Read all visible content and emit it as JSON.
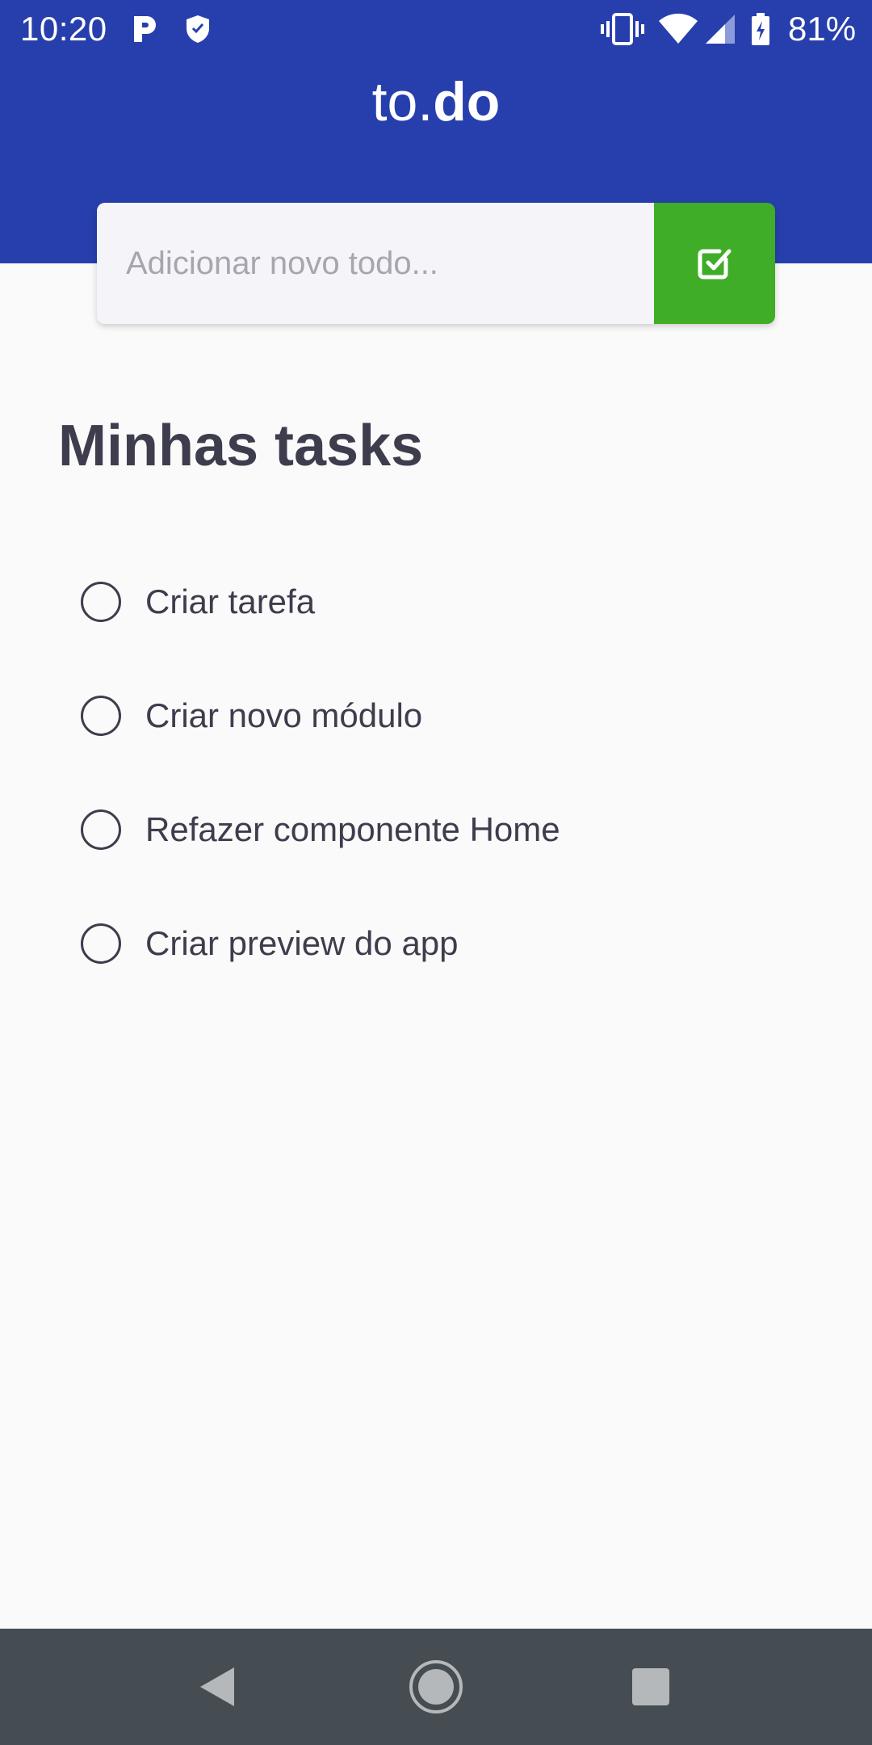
{
  "status_bar": {
    "time": "10:20",
    "battery": "81%",
    "icons": [
      "parking-app-icon",
      "shield-icon",
      "vibrate-icon",
      "wifi-icon",
      "cell-signal-icon",
      "battery-charging-icon"
    ]
  },
  "header": {
    "title_light": "to.",
    "title_bold": "do",
    "background_color": "#273FAD"
  },
  "new_todo": {
    "placeholder": "Adicionar novo todo...",
    "submit_icon": "checkbox-check-icon",
    "submit_color": "#3FAD27"
  },
  "tasks": {
    "title": "Minhas tasks",
    "items": [
      {
        "label": "Criar tarefa",
        "done": false
      },
      {
        "label": "Criar novo módulo",
        "done": false
      },
      {
        "label": "Refazer componente Home",
        "done": false
      },
      {
        "label": "Criar preview do app",
        "done": false
      }
    ]
  },
  "nav_bar": {
    "buttons": [
      "back-icon",
      "home-icon",
      "recents-icon"
    ]
  }
}
